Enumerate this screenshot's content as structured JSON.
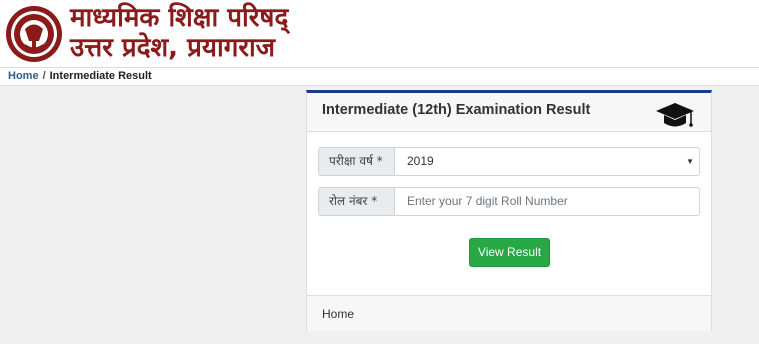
{
  "header": {
    "title_line1": "माध्यमिक शिक्षा परिषद्",
    "title_line2": "उत्तर प्रदेश, प्रयागराज",
    "logo_icon": "board-seal-icon",
    "title_color": "#8b1a1a"
  },
  "breadcrumb": {
    "home": "Home",
    "separator": "/",
    "current": "Intermediate Result"
  },
  "card": {
    "title": "Intermediate (12th) Examination Result",
    "header_icon": "graduation-cap-icon",
    "accent_color": "#1a3a8a",
    "year_field": {
      "label": "परीक्षा वर्ष *",
      "selected": "2019"
    },
    "roll_field": {
      "label": "रोल नंबर *",
      "value": "",
      "placeholder": "Enter your 7 digit Roll Number"
    },
    "submit_label": "View Result",
    "submit_color": "#28a745",
    "footer_link": "Home"
  }
}
